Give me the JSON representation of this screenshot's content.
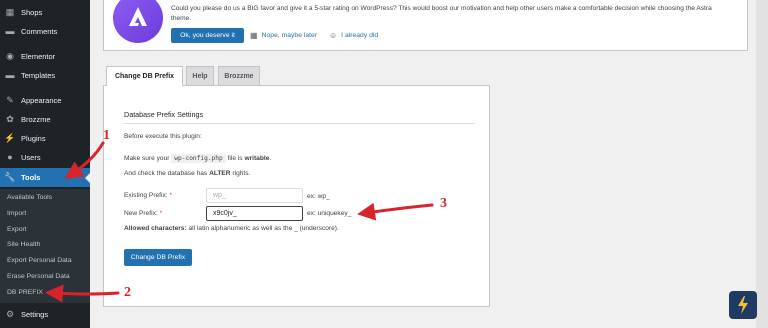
{
  "sidebar": {
    "items": [
      {
        "label": "Shops",
        "icon": "shop-icon"
      },
      {
        "label": "Comments",
        "icon": "comments-icon"
      },
      {
        "label": "Elementor",
        "icon": "elementor-icon"
      },
      {
        "label": "Templates",
        "icon": "folder-icon"
      },
      {
        "label": "Appearance",
        "icon": "brush-icon"
      },
      {
        "label": "Brozzme",
        "icon": "brozzme-icon"
      },
      {
        "label": "Plugins",
        "icon": "plug-icon"
      },
      {
        "label": "Users",
        "icon": "users-icon"
      },
      {
        "label": "Tools",
        "icon": "wrench-icon"
      },
      {
        "label": "Settings",
        "icon": "settings-icon"
      }
    ],
    "submenu": [
      "Available Tools",
      "Import",
      "Export",
      "Site Health",
      "Export Personal Data",
      "Erase Personal Data",
      "DB PREFIX"
    ]
  },
  "notice": {
    "text": "Could you please do us a BIG favor and give it a 5-star rating on WordPress? This would boost our motivation and help other users make a comfortable decision while choosing the Astra theme.",
    "primary_button": "Ok, you deserve it",
    "link_later": "Nope, maybe later",
    "link_done": "I already did"
  },
  "tabs": [
    "Change DB Prefix",
    "Help",
    "Brozzme"
  ],
  "form": {
    "title": "Database Prefix Settings",
    "before": "Before execute this plugin:",
    "make_sure_prefix": "Make sure your",
    "config_file": "wp-config.php",
    "make_sure_middle": "file is",
    "writable": "writable",
    "make_sure_end": ".",
    "check_prefix": "And check the database has",
    "alter": "ALTER",
    "check_end": "rights.",
    "existing_label": "Existing Prefix:",
    "existing_value": "wp_",
    "existing_hint": "ex: wp_",
    "new_label": "New Prefix:",
    "new_value": "x9c0jv_",
    "new_hint": "ex: uniquekey_",
    "allowed_label": "Allowed characters:",
    "allowed_text": "all latin alphanumeric as well as the _ (underscore).",
    "submit": "Change DB Prefix",
    "required_mark": "*"
  },
  "annotations": [
    "1",
    "2",
    "3"
  ],
  "colors": {
    "accent": "#2271b1",
    "sidebar": "#1d2327",
    "annotation": "#d8232a"
  }
}
